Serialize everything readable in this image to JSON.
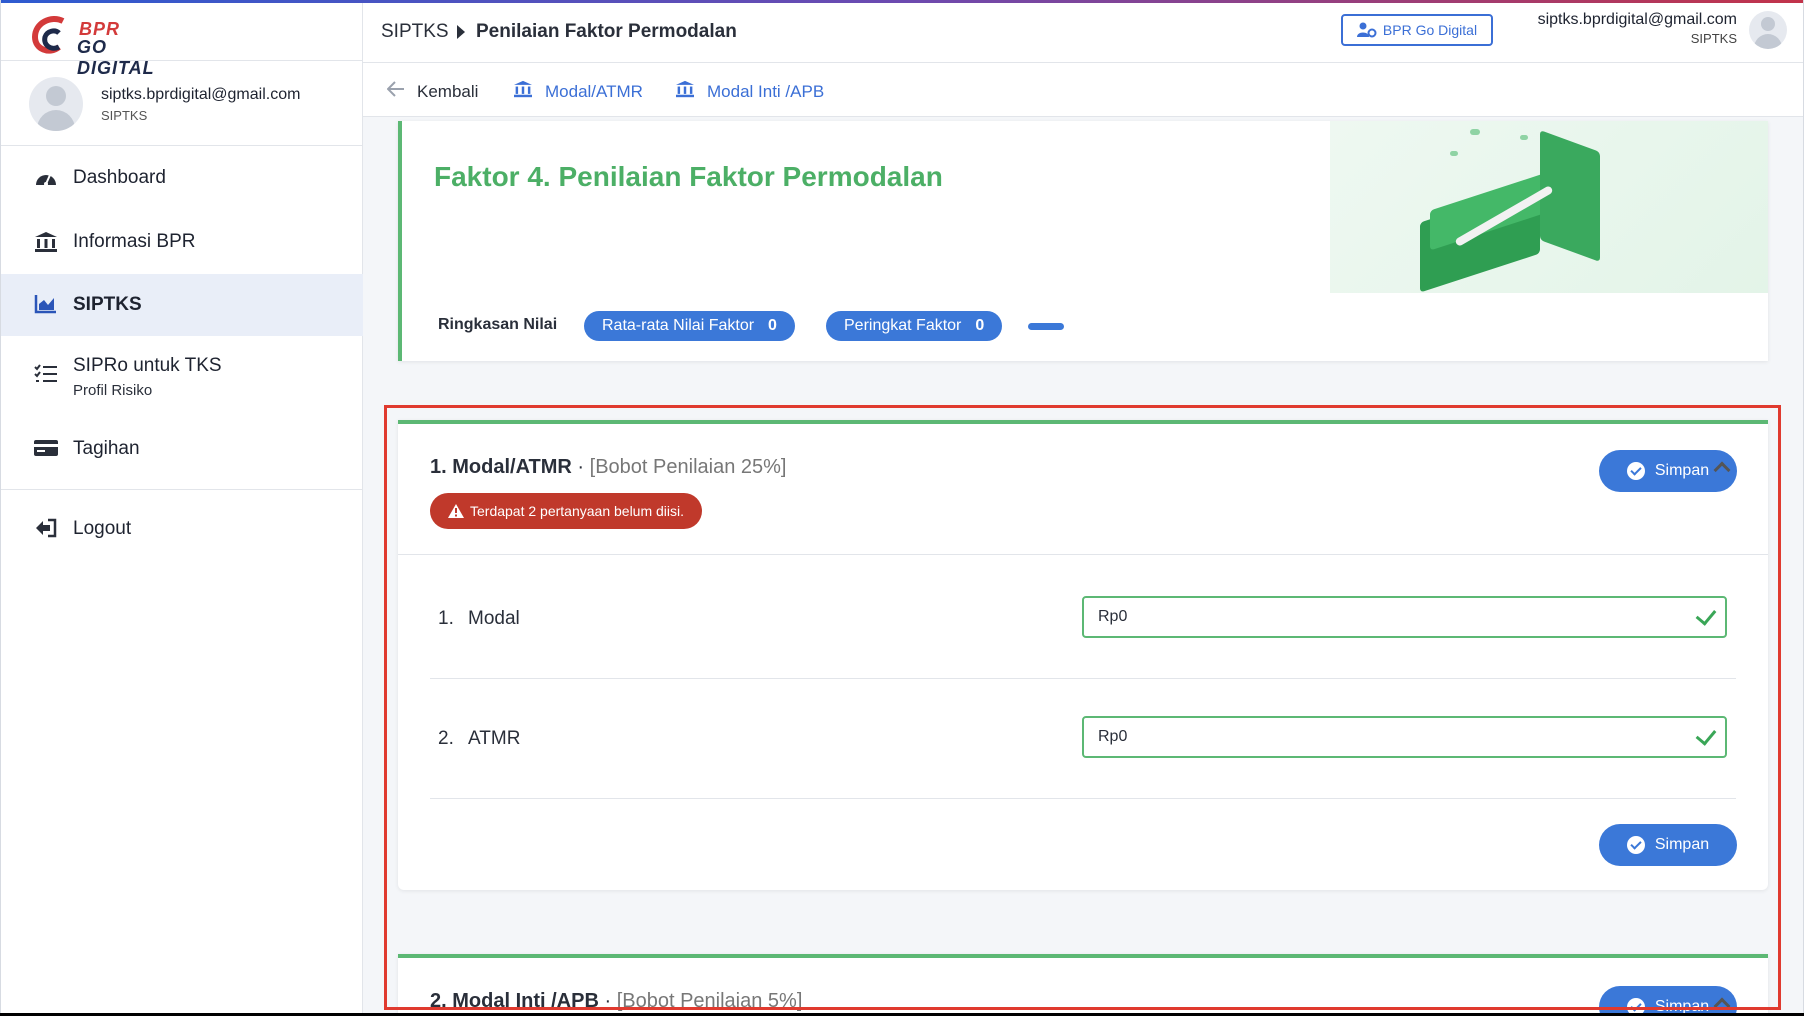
{
  "brand": {
    "logo_top": "BPR",
    "logo_bottom": "GO DIGITAL"
  },
  "sidebar": {
    "user_email": "siptks.bprdigital@gmail.com",
    "user_role": "SIPTKS",
    "items": [
      {
        "label": "Dashboard",
        "icon": "dashboard-icon"
      },
      {
        "label": "Informasi BPR",
        "icon": "bank-icon"
      },
      {
        "label": "SIPTKS",
        "icon": "chart-icon",
        "active": true
      },
      {
        "label": "SIPRo untuk TKS",
        "sub": "Profil Risiko",
        "icon": "checklist-icon"
      },
      {
        "label": "Tagihan",
        "icon": "card-icon"
      },
      {
        "label": "Logout",
        "icon": "logout-icon"
      }
    ]
  },
  "header": {
    "breadcrumb_root": "SIPTKS",
    "breadcrumb_current": "Penilaian Faktor Permodalan",
    "portal_button": "BPR Go Digital",
    "user_email": "siptks.bprdigital@gmail.com",
    "user_role": "SIPTKS"
  },
  "subnav": {
    "back": "Kembali",
    "links": [
      "Modal/ATMR",
      "Modal Inti /APB"
    ]
  },
  "hero": {
    "title": "Faktor 4. Penilaian Faktor Permodalan",
    "summary_label": "Ringkasan Nilai",
    "avg_label": "Rata-rata Nilai Faktor",
    "avg_value": "0",
    "rank_label": "Peringkat Faktor",
    "rank_value": "0"
  },
  "section1": {
    "title": "1. Modal/ATMR",
    "separator": "·",
    "weight": "[Bobot Penilaian 25%]",
    "warning": "Terdapat 2 pertanyaan belum diisi.",
    "save_label": "Simpan",
    "questions": [
      {
        "num": "1.",
        "label": "Modal",
        "value": "Rp0"
      },
      {
        "num": "2.",
        "label": "ATMR",
        "value": "Rp0"
      }
    ]
  },
  "section2": {
    "title": "2. Modal Inti /APB",
    "separator": "·",
    "weight": "[Bobot Penilaian 5%]",
    "save_label": "Simpan"
  },
  "colors": {
    "accent_blue": "#3b78d8",
    "accent_green": "#4caf66",
    "warning_red": "#c0392b",
    "highlight_red": "#e03a2f"
  }
}
